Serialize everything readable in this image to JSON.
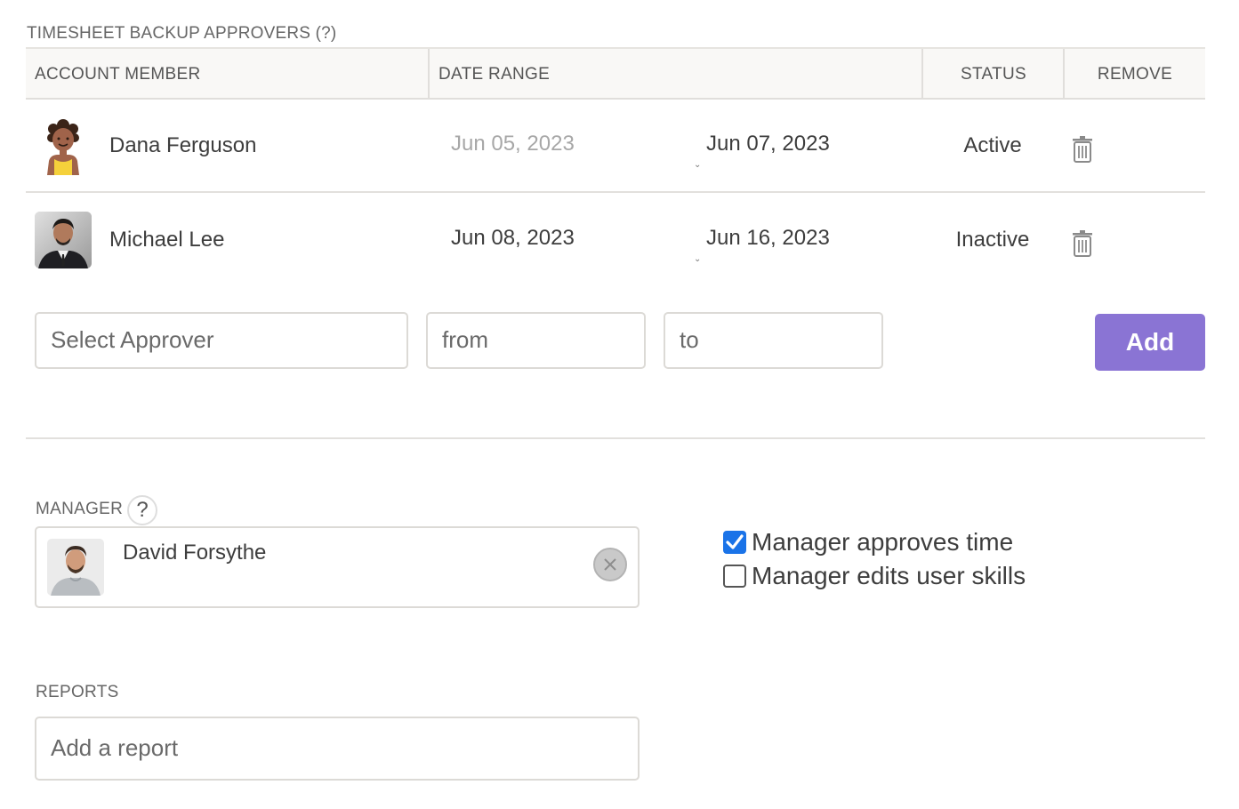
{
  "backup_approvers": {
    "title": "TIMESHEET BACKUP APPROVERS (?)",
    "columns": {
      "member": "ACCOUNT MEMBER",
      "date_range": "DATE RANGE",
      "status": "STATUS",
      "remove": "REMOVE"
    },
    "rows": [
      {
        "name": "Dana Ferguson",
        "from": "Jun 05, 2023",
        "to": "Jun 07, 2023",
        "status": "Active",
        "avatar": "illustrated-avatar"
      },
      {
        "name": "Michael Lee",
        "from": "Jun 08, 2023",
        "to": "Jun 16, 2023",
        "status": "Inactive",
        "avatar": "photo-avatar"
      }
    ],
    "add_form": {
      "approver_placeholder": "Select Approver",
      "from_placeholder": "from",
      "to_placeholder": "to",
      "add_label": "Add"
    }
  },
  "manager": {
    "label": "MANAGER",
    "help": "?",
    "name": "David Forsythe",
    "options": [
      {
        "label": "Manager approves time",
        "checked": true
      },
      {
        "label": "Manager edits user skills",
        "checked": false
      }
    ]
  },
  "reports": {
    "label": "REPORTS",
    "placeholder": "Add a report"
  },
  "colors": {
    "accent": "#8a74d4",
    "checkbox": "#1a73e8"
  }
}
